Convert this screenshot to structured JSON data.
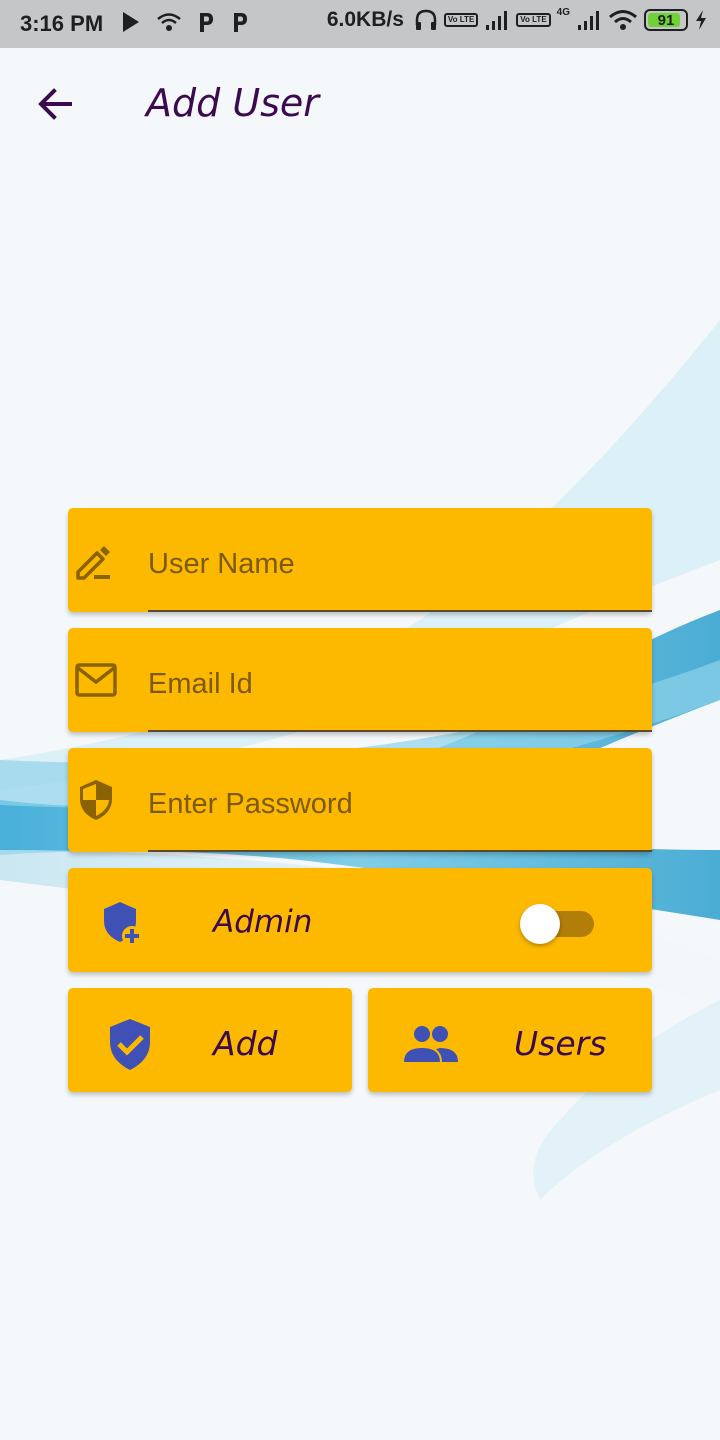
{
  "status_bar": {
    "time": "3:16 PM",
    "speed": "6.0KB/s",
    "volte_1": "Vo LTE",
    "volte_2": "Vo LTE",
    "network_type": "4G",
    "battery": "91"
  },
  "app_bar": {
    "title": "Add User",
    "back_icon": "arrow-left-icon"
  },
  "form": {
    "user_name": {
      "value": "",
      "placeholder": "User Name",
      "icon": "edit-pencil-icon"
    },
    "email": {
      "value": "",
      "placeholder": "Email Id",
      "icon": "mail-icon"
    },
    "password": {
      "value": "",
      "placeholder": "Enter Password",
      "icon": "security-shield-icon"
    },
    "admin": {
      "label": "Admin",
      "icon": "shield-add-icon",
      "enabled": false
    }
  },
  "actions": {
    "add_label": "Add",
    "users_label": "Users"
  },
  "colors": {
    "card": "#fdb900",
    "title_text": "#3b0a4f",
    "icon_blue": "#3f51b5",
    "icon_brown": "#8a6300"
  }
}
